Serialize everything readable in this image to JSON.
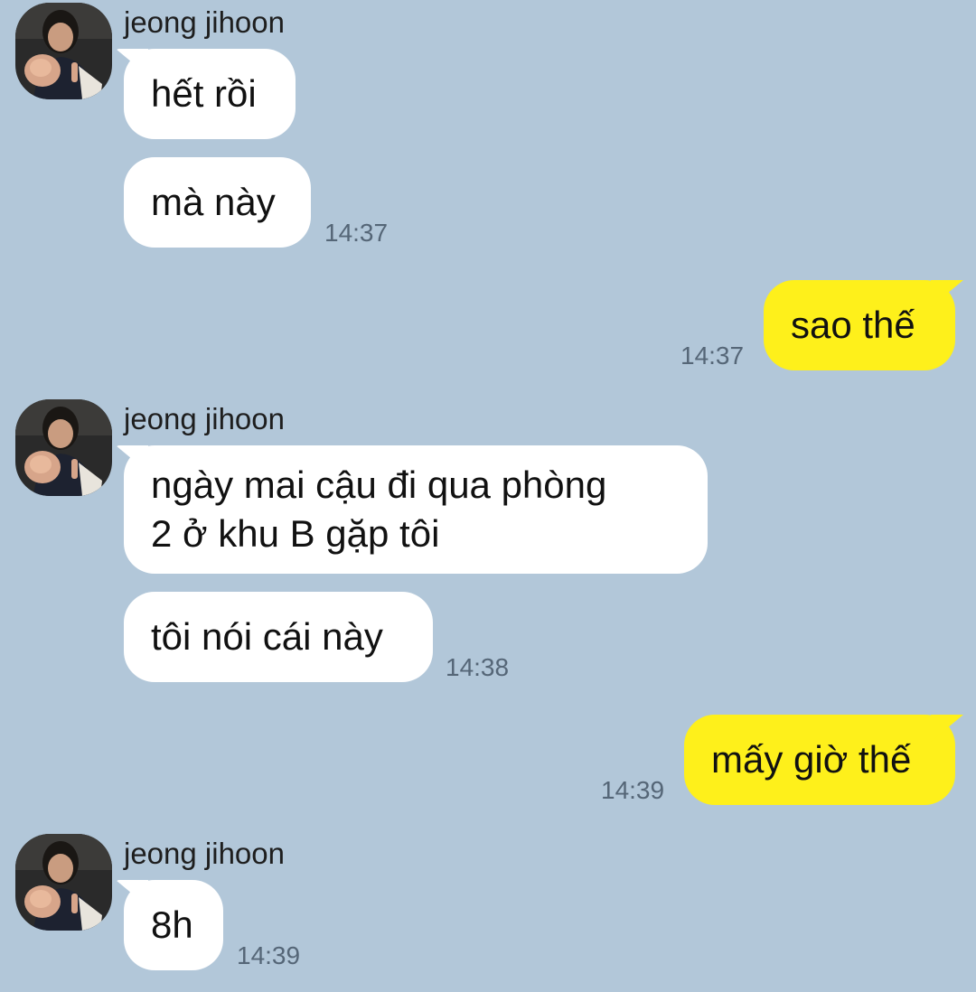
{
  "contact": {
    "name": "jeong jihoon"
  },
  "groups": [
    {
      "sender": "jeong jihoon",
      "messages": [
        "hết rồi",
        "mà này"
      ],
      "time": "14:37"
    },
    {
      "me": true,
      "messages": [
        "sao thế"
      ],
      "time": "14:37"
    },
    {
      "sender": "jeong jihoon",
      "messages": [
        "ngày mai cậu đi qua phòng\n2 ở khu B gặp tôi",
        "tôi nói cái này"
      ],
      "time": "14:38"
    },
    {
      "me": true,
      "messages": [
        "mấy giờ thế"
      ],
      "time": "14:39"
    },
    {
      "sender": "jeong jihoon",
      "messages": [
        "8h"
      ],
      "time": "14:39"
    }
  ],
  "colors": {
    "background": "#b2c7d9",
    "incoming_bubble": "#ffffff",
    "outgoing_bubble": "#fef01b",
    "timestamp": "#556677"
  },
  "icons": {
    "avatar": "profile-photo-avatar"
  }
}
